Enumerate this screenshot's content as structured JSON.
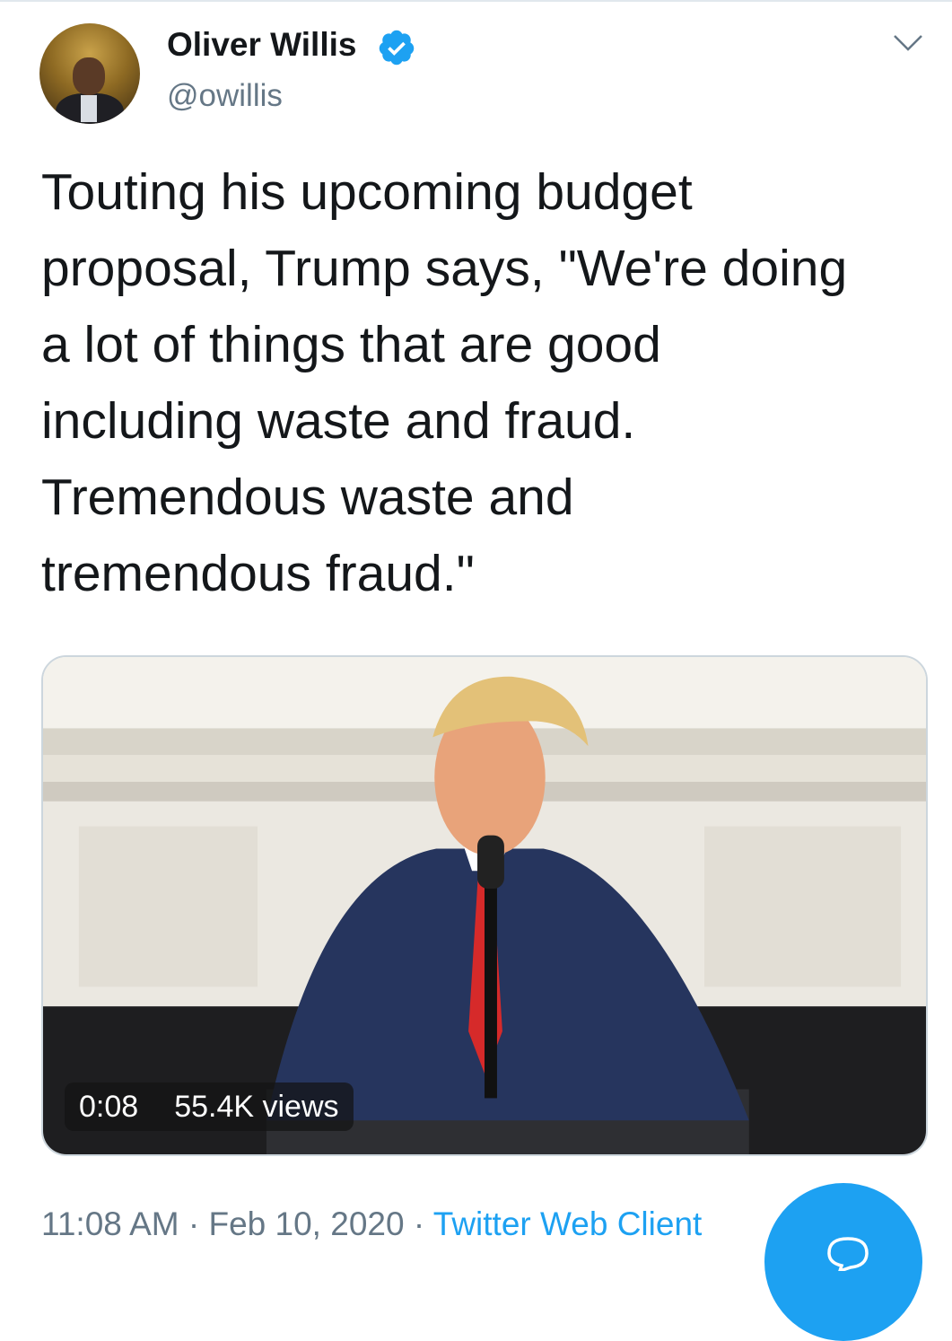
{
  "author": {
    "display_name": "Oliver Willis",
    "handle": "@owillis"
  },
  "tweet": {
    "text": "Touting his upcoming budget\nproposal, Trump says, \"We're doing\na lot of things that are good\nincluding waste and fraud.\nTremendous waste and\ntremendous fraud.\""
  },
  "video": {
    "duration": "0:08",
    "views": "55.4K views"
  },
  "meta": {
    "time": "11:08 AM",
    "date": "Feb 10, 2020",
    "separator": "·",
    "source": "Twitter Web Client"
  },
  "colors": {
    "accent": "#1da1f2",
    "secondary_text": "#657786",
    "primary_text": "#14171a"
  },
  "icons": {
    "verified": "verified-badge-icon",
    "more": "chevron-down-icon",
    "compose": "speech-bubble-icon"
  }
}
